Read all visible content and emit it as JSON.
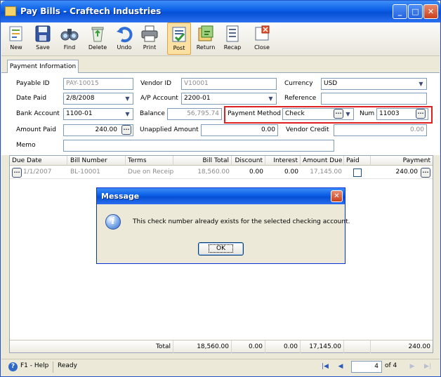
{
  "window": {
    "title": "Pay Bills - Craftech Industries"
  },
  "toolbar": {
    "new": "New",
    "save": "Save",
    "find": "Find",
    "delete": "Delete",
    "undo": "Undo",
    "print": "Print",
    "post": "Post",
    "return": "Return",
    "recap": "Recap",
    "close": "Close"
  },
  "tabs": {
    "payment_info": "Payment Information"
  },
  "form": {
    "payable_id_label": "Payable ID",
    "payable_id": "PAY-10015",
    "vendor_id_label": "Vendor ID",
    "vendor_id": "V10001",
    "currency_label": "Currency",
    "currency": "USD",
    "date_paid_label": "Date Paid",
    "date_paid": "2/8/2008",
    "ap_account_label": "A/P Account",
    "ap_account": "2200-01",
    "reference_label": "Reference",
    "reference": "",
    "bank_account_label": "Bank Account",
    "bank_account": "1100-01",
    "balance_label": "Balance",
    "balance": "56,795.74",
    "payment_method_label": "Payment Method",
    "payment_method": "Check",
    "num_label": "Num",
    "num": "11003",
    "amount_paid_label": "Amount Paid",
    "amount_paid": "240.00",
    "unapplied_label": "Unapplied Amount",
    "unapplied": "0.00",
    "vendor_credit_label": "Vendor Credit",
    "vendor_credit": "0.00",
    "memo_label": "Memo",
    "memo": ""
  },
  "grid": {
    "headers": {
      "due_date": "Due Date",
      "bill_number": "Bill Number",
      "terms": "Terms",
      "bill_total": "Bill Total",
      "discount": "Discount",
      "interest": "Interest",
      "amount_due": "Amount Due",
      "paid": "Paid",
      "payment": "Payment"
    },
    "row": {
      "due_date": "1/1/2007",
      "bill_number": "BL-10001",
      "terms": "Due on Receip",
      "bill_total": "18,560.00",
      "discount": "0.00",
      "interest": "0.00",
      "amount_due": "17,145.00",
      "paid": false,
      "payment": "240.00"
    },
    "footer": {
      "total_label": "Total",
      "bill_total": "18,560.00",
      "discount": "0.00",
      "interest": "0.00",
      "amount_due": "17,145.00",
      "payment": "240.00"
    }
  },
  "status": {
    "help": "F1 - Help",
    "state": "Ready",
    "page": "4",
    "of_label": "of 4"
  },
  "dialog": {
    "title": "Message",
    "message": "This check number already exists for the selected checking account.",
    "ok": "OK"
  }
}
